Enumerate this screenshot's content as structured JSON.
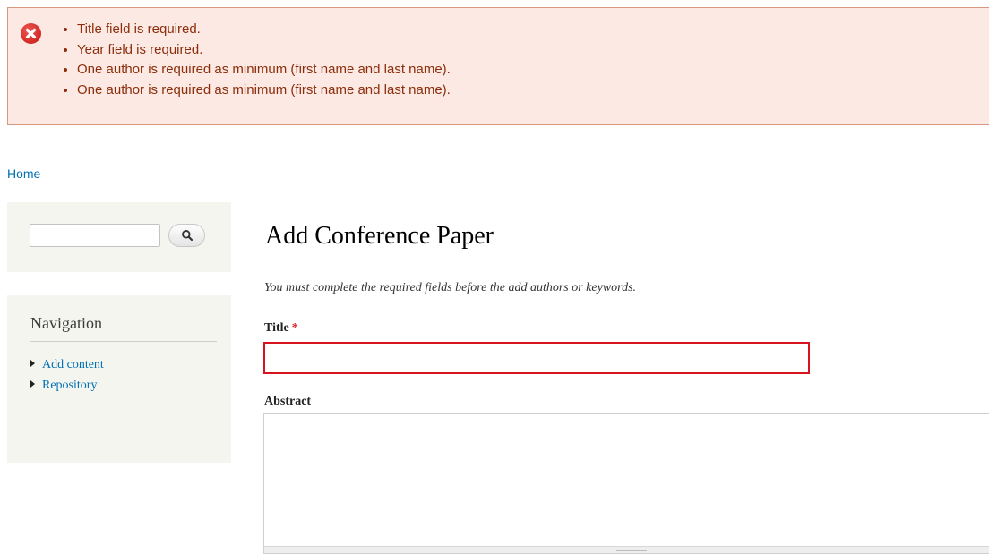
{
  "messages": {
    "icon": "error-icon",
    "items": [
      "Title field is required.",
      "Year field is required.",
      "One author is required as minimum (first name and last name).",
      "One author is required as minimum (first name and last name)."
    ]
  },
  "breadcrumb": {
    "home": "Home"
  },
  "search": {
    "value": "",
    "button_icon": "search-icon"
  },
  "navigation": {
    "title": "Navigation",
    "items": [
      {
        "label": "Add content"
      },
      {
        "label": "Repository"
      }
    ]
  },
  "page": {
    "title": "Add Conference Paper",
    "description": "You must complete the required fields before the add authors or keywords."
  },
  "form": {
    "title_label": "Title",
    "title_required": "*",
    "title_value": "",
    "abstract_label": "Abstract",
    "abstract_value": ""
  },
  "colors": {
    "error_background": "#fce9e4",
    "error_border": "#d7977f",
    "error_text": "#8c2e0b",
    "link": "#0071b3",
    "invalid_field_border": "#d6131e",
    "sidebar_background": "#f5f5f0"
  }
}
